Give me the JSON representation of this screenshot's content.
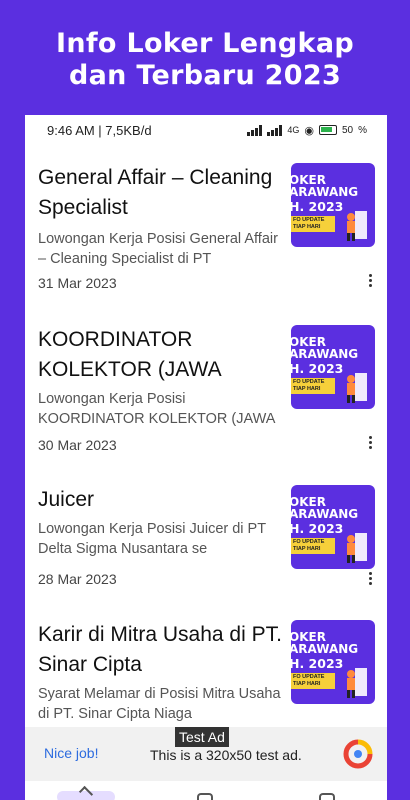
{
  "promo": {
    "line1": "Info Loker Lengkap",
    "line2": "dan Terbaru 2023"
  },
  "status_bar": {
    "time_speed": "9:46 AM | 7,5KB/d",
    "network": "4G",
    "battery": "50"
  },
  "items": [
    {
      "title": "General Affair – Cleaning Specialist",
      "desc": "Lowongan Kerja Posisi General Affair – Cleaning Specialist di PT",
      "date": "31 Mar 2023",
      "thumb_l1": "OKER",
      "thumb_l2": "ARAWANG",
      "thumb_l3": "H. 2023",
      "thumb_badge": "FO UPDATE TIAP HARI"
    },
    {
      "title": "KOORDINATOR KOLEKTOR (JAWA",
      "desc": "Lowongan Kerja Posisi KOORDINATOR KOLEKTOR (JAWA",
      "date": "30 Mar 2023",
      "thumb_l1": "OKER",
      "thumb_l2": "ARAWANG",
      "thumb_l3": "H. 2023",
      "thumb_badge": "FO UPDATE TIAP HARI"
    },
    {
      "title": "Juicer",
      "desc": "Lowongan Kerja Posisi Juicer di PT Delta Sigma Nusantara se",
      "date": "28 Mar 2023",
      "thumb_l1": "OKER",
      "thumb_l2": "ARAWANG",
      "thumb_l3": "H. 2023",
      "thumb_badge": "FO UPDATE TIAP HARI"
    },
    {
      "title": "Karir di Mitra Usaha di PT. Sinar Cipta",
      "desc": "Syarat Melamar di Posisi Mitra Usaha di PT. Sinar Cipta Niaga",
      "date": "",
      "thumb_l1": "OKER",
      "thumb_l2": "ARAWANG",
      "thumb_l3": "H. 2023",
      "thumb_badge": "FO UPDATE TIAP HARI"
    }
  ],
  "ad": {
    "label": "Test Ad",
    "nice": "Nice job!",
    "text": "This is a 320x50 test ad."
  },
  "colors": {
    "brand": "#5b2fe0",
    "badge": "#f6d03a",
    "link": "#2d6cdf"
  }
}
